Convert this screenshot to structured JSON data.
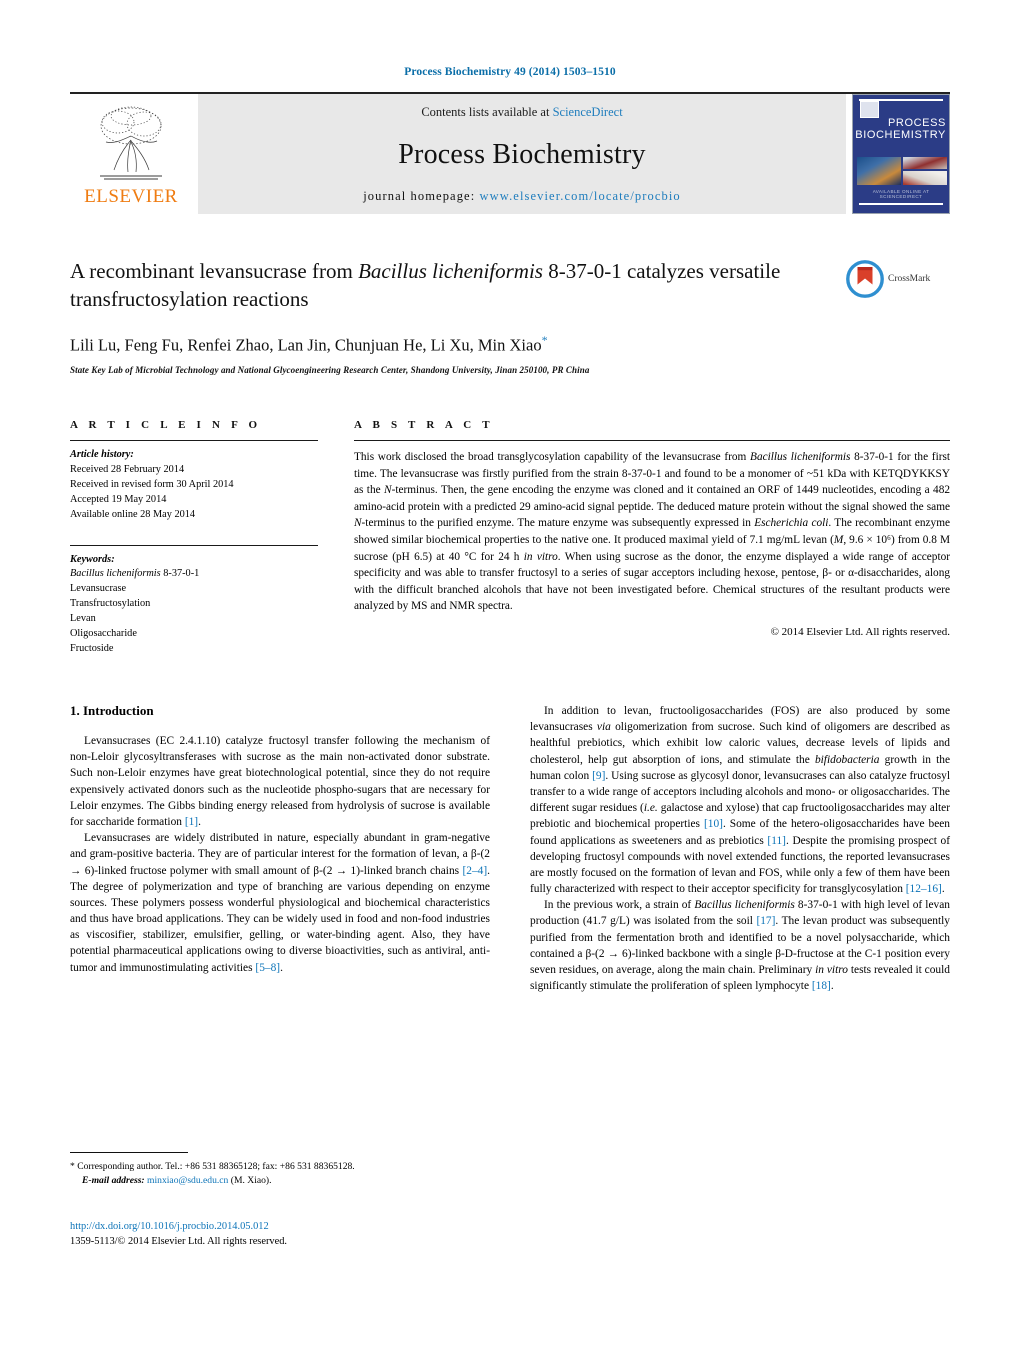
{
  "running_head": "Process Biochemistry 49 (2014) 1503–1510",
  "masthead": {
    "publisher": "ELSEVIER",
    "contents_prefix": "Contents lists available at ",
    "sciencedirect": "ScienceDirect",
    "journal_title": "Process Biochemistry",
    "homepage_prefix": "journal homepage: ",
    "homepage_url": "www.elsevier.com/locate/procbio",
    "cover": {
      "title_line1": "PROCESS",
      "title_line2": "BIOCHEMISTRY",
      "footer": "AVAILABLE ONLINE AT SCIENCEDIRECT"
    }
  },
  "article": {
    "title_part1": "A recombinant levansucrase from ",
    "title_italic": "Bacillus licheniformis",
    "title_part2": " 8-37-0-1 catalyzes versatile transfructosylation reactions",
    "authors": "Lili Lu, Feng Fu, Renfei Zhao, Lan Jin, Chunjuan He, Li Xu, Min Xiao",
    "author_star": "*",
    "affiliation": "State Key Lab of Microbial Technology and National Glycoengineering Research Center, Shandong University, Jinan 250100, PR China",
    "crossmark_label": "CrossMark"
  },
  "article_info": {
    "heading": "A R T I C L E   I N F O",
    "history_label": "Article history:",
    "history": [
      "Received 28 February 2014",
      "Received in revised form 30 April 2014",
      "Accepted 19 May 2014",
      "Available online 28 May 2014"
    ],
    "keywords_label": "Keywords:",
    "keyword_italic": "Bacillus licheniformis",
    "keyword_italic_suffix": " 8-37-0-1",
    "keywords": [
      "Levansucrase",
      "Transfructosylation",
      "Levan",
      "Oligosaccharide",
      "Fructoside"
    ]
  },
  "abstract": {
    "heading": "A B S T R A C T",
    "p1": "This work disclosed the broad transglycosylation capability of the levansucrase from ",
    "p1_i1": "Bacillus licheniformis",
    "p2": " 8-37-0-1 for the first time. The levansucrase was firstly purified from the strain 8-37-0-1 and found to be a monomer of ~51 kDa with KETQDYKKSY as the ",
    "p2_i": "N",
    "p3": "-terminus. Then, the gene encoding the enzyme was cloned and it contained an ORF of 1449 nucleotides, encoding a 482 amino-acid protein with a predicted 29 amino-acid signal peptide. The deduced mature protein without the signal showed the same ",
    "p3_i": "N",
    "p4": "-terminus to the purified enzyme. The mature enzyme was subsequently expressed in ",
    "p4_i": "Escherichia coli",
    "p5": ". The recombinant enzyme showed similar biochemical properties to the native one. It produced maximal yield of 7.1 mg/mL levan (",
    "p5_i": "M",
    "p6": ", 9.6 × 10⁶) from 0.8 M sucrose (pH 6.5) at 40 °C for 24 h ",
    "p6_i": "in vitro",
    "p7": ". When using sucrose as the donor, the enzyme displayed a wide range of acceptor specificity and was able to transfer fructosyl to a series of sugar acceptors including hexose, pentose, β- or α-disaccharides, along with the difficult branched alcohols that have not been investigated before. Chemical structures of the resultant products were analyzed by MS and NMR spectra.",
    "copyright": "© 2014 Elsevier Ltd. All rights reserved."
  },
  "introduction": {
    "heading": "1.  Introduction",
    "left_p1_a": "Levansucrases (EC 2.4.1.10) catalyze fructosyl transfer following the mechanism of non-Leloir glycosyltransferases with sucrose as the main non-activated donor substrate. Such non-Leloir enzymes have great biotechnological potential, since they do not require expensively activated donors such as the nucleotide phospho-sugars that are necessary for Leloir enzymes. The Gibbs binding energy released from hydrolysis of sucrose is available for saccharide formation ",
    "left_p1_ref": "[1]",
    "left_p1_b": ".",
    "left_p2_a": "Levansucrases are widely distributed in nature, especially abundant in gram-negative and gram-positive bacteria. They are of particular interest for the formation of levan, a β-(2 → 6)-linked fructose polymer with small amount of β-(2 → 1)-linked branch chains ",
    "left_p2_ref1": "[2–4]",
    "left_p2_b": ". The degree of polymerization and type of branching are various depending on enzyme sources. These polymers possess wonderful physiological and biochemical characteristics and thus have broad applications. They can be widely used in food and non-food industries as viscosifier, stabilizer, emulsifier, gelling, or water-binding agent. Also, they have potential pharmaceutical applications owing to diverse bioactivities, such as antiviral, anti-tumor and immunostimulating activities ",
    "left_p2_ref2": "[5–8]",
    "left_p2_c": ".",
    "right_p1_a": "In addition to levan, fructooligosaccharides (FOS) are also produced by some levansucrases ",
    "right_p1_i1": "via",
    "right_p1_b": " oligomerization from sucrose. Such kind of oligomers are described as healthful prebiotics, which exhibit low caloric values, decrease levels of lipids and cholesterol, help gut absorption of ions, and stimulate the ",
    "right_p1_i2": "bifidobacteria",
    "right_p1_c": " growth in the human colon ",
    "right_p1_ref1": "[9]",
    "right_p1_d": ". Using sucrose as glycosyl donor, levansucrases can also catalyze fructosyl transfer to a wide range of acceptors including alcohols and mono- or oligosaccharides. The different sugar residues (",
    "right_p1_i3": "i.e.",
    "right_p1_e": " galactose and xylose) that cap fructooligosaccharides may alter prebiotic and biochemical properties ",
    "right_p1_ref2": "[10]",
    "right_p1_f": ". Some of the hetero-oligosaccharides have been found applications as sweeteners and as prebiotics ",
    "right_p1_ref3": "[11]",
    "right_p1_g": ". Despite the promising prospect of developing fructosyl compounds with novel extended functions, the reported levansucrases are mostly focused on the formation of levan and FOS, while only a few of them have been fully characterized with respect to their acceptor specificity for transglycosylation ",
    "right_p1_ref4": "[12–16]",
    "right_p1_h": ".",
    "right_p2_a": "In the previous work, a strain of ",
    "right_p2_i1": "Bacillus licheniformis",
    "right_p2_b": " 8-37-0-1 with high level of levan production (41.7 g/L) was isolated from the soil ",
    "right_p2_ref1": "[17]",
    "right_p2_c": ". The levan product was subsequently purified from the fermentation broth and identified to be a novel polysaccharide, which contained a β-(2 → 6)-linked backbone with a single β-D-fructose at the C-1 position every seven residues, on average, along the main chain. Preliminary ",
    "right_p2_i2": "in vitro",
    "right_p2_d": " tests revealed it could significantly stimulate the proliferation of spleen lymphocyte ",
    "right_p2_ref2": "[18]",
    "right_p2_e": "."
  },
  "footnote": {
    "star": "*",
    "text": " Corresponding author. Tel.: +86 531 88365128; fax: +86 531 88365128.",
    "email_label": "E-mail address:",
    "email": "minxiao@sdu.edu.cn",
    "email_suffix": " (M. Xiao)."
  },
  "doi": {
    "url": "http://dx.doi.org/10.1016/j.procbio.2014.05.012",
    "issn_line": "1359-5113/© 2014 Elsevier Ltd. All rights reserved."
  },
  "colors": {
    "link": "#0d74b8",
    "header_blue": "#0b6ea8",
    "elsevier_orange": "#ef7c12",
    "band_gray": "#e8e8e8"
  }
}
